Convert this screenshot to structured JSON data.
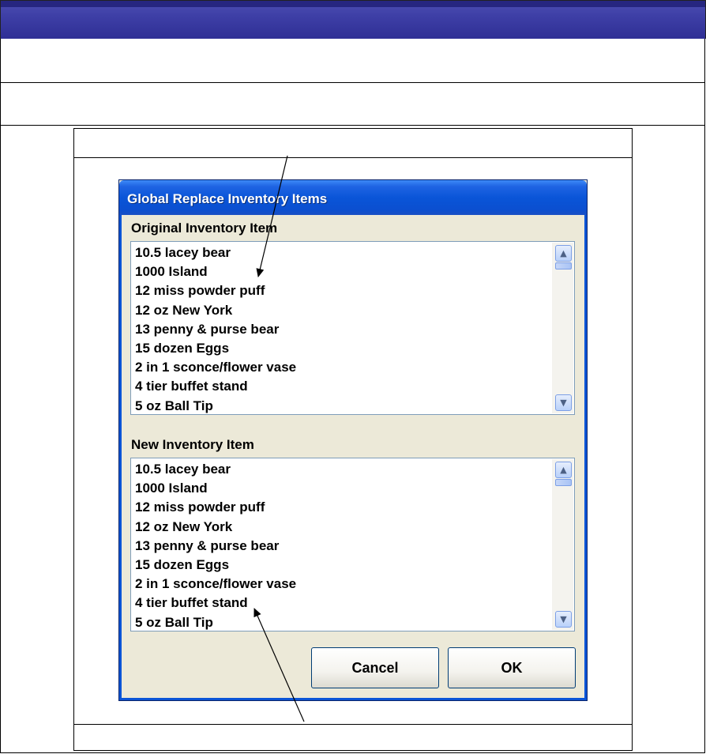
{
  "dialog": {
    "title": "Global Replace Inventory Items",
    "original_label": "Original Inventory Item",
    "new_label": "New Inventory Item",
    "original_items": [
      "10.5 lacey bear",
      "1000 Island",
      "12 miss powder puff",
      "12 oz New York",
      "13 penny & purse bear",
      "15 dozen Eggs",
      "2 in 1 sconce/flower vase",
      "4 tier buffet stand",
      "5 oz Ball Tip"
    ],
    "new_items": [
      "10.5 lacey bear",
      "1000 Island",
      "12 miss powder puff",
      "12 oz New York",
      "13 penny & purse bear",
      "15 dozen Eggs",
      "2 in 1 sconce/flower vase",
      "4 tier buffet stand",
      "5 oz Ball Tip"
    ],
    "cancel_label": "Cancel",
    "ok_label": "OK"
  },
  "icons": {
    "scroll_up": "chevron-up-icon",
    "scroll_down": "chevron-down-icon"
  },
  "colors": {
    "header_bar": "#3e3fa6",
    "titlebar": "#0a55d8",
    "dialog_bg": "#ece9d8"
  }
}
